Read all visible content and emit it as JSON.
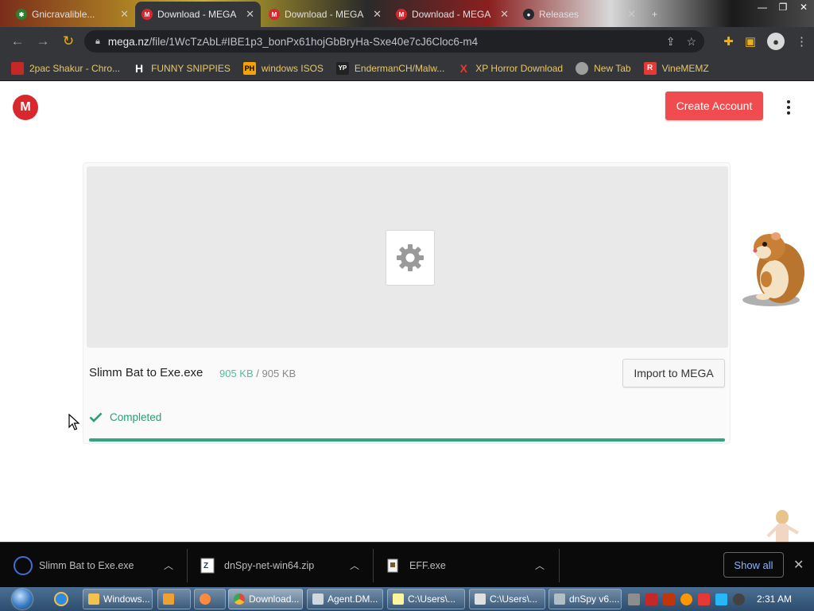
{
  "browser": {
    "tabs": [
      {
        "title": "Gnicravalible...",
        "favicon": "green-leaf-icon",
        "active": false
      },
      {
        "title": "Download - MEGA",
        "favicon": "mega-icon",
        "active": true
      },
      {
        "title": "Download - MEGA",
        "favicon": "mega-icon",
        "active": false
      },
      {
        "title": "Download - MEGA",
        "favicon": "mega-icon",
        "active": false
      },
      {
        "title": "Releases",
        "favicon": "github-icon",
        "active": false
      }
    ],
    "new_tab": "+",
    "address": {
      "domain": "mega.nz",
      "path": "/file/1WcTzAbL#IBE1p3_bonPx61hojGbBryHa-Sxe40e7cJ6Cloc6-m4"
    },
    "bookmarks": [
      {
        "label": "2pac Shakur - Chro...",
        "icon": "chrome-web-store-icon",
        "icon_text": "",
        "icon_color": "#c62828"
      },
      {
        "label": "FUNNY SNIPPIES",
        "icon": "h-icon",
        "icon_text": "H",
        "icon_color": "#ffffff"
      },
      {
        "label": "windows ISOS",
        "icon": "ph-icon",
        "icon_text": "PH",
        "icon_color": "#f7a400"
      },
      {
        "label": "EndermanCH/Malw...",
        "icon": "yp-icon",
        "icon_text": "YP",
        "icon_color": "#ffffff"
      },
      {
        "label": "XP Horror Download",
        "icon": "x-icon",
        "icon_text": "X",
        "icon_color": "#e53935"
      },
      {
        "label": "New Tab",
        "icon": "globe-icon",
        "icon_text": "",
        "icon_color": "#9e9e9e"
      },
      {
        "label": "VineMEMZ",
        "icon": "r-icon",
        "icon_text": "R",
        "icon_color": "#e53935"
      }
    ]
  },
  "page": {
    "logo_letter": "M",
    "create_account": "Create Account",
    "file": {
      "name": "Slimm Bat to Exe.exe",
      "downloaded": "905 KB",
      "separator": "/",
      "total": "905 KB"
    },
    "import_button": "Import to MEGA",
    "status": "Completed",
    "progress": 1.0
  },
  "downloads": [
    {
      "name": "Slimm Bat to Exe.exe",
      "icon": "loading-ring-icon"
    },
    {
      "name": "dnSpy-net-win64.zip",
      "icon": "zip-file-icon"
    },
    {
      "name": "EFF.exe",
      "icon": "exe-file-icon"
    }
  ],
  "show_all": "Show all",
  "taskbar": {
    "items": [
      {
        "label": "Windows...",
        "icon": "explorer-icon",
        "color": "#f2c14e"
      },
      {
        "label": "",
        "icon": "media-player-icon",
        "color": "#f0a030"
      },
      {
        "label": "",
        "icon": "app-icon",
        "color": "#ff8a3d"
      },
      {
        "label": "Download...",
        "icon": "chrome-icon",
        "color": "#e8453c",
        "active": true
      },
      {
        "label": "Agent.DM...",
        "icon": "window-icon",
        "color": "#cfd8dc"
      },
      {
        "label": "C:\\Users\\...",
        "icon": "notepad-icon",
        "color": "#fff59d"
      },
      {
        "label": "C:\\Users\\...",
        "icon": "7zip-icon",
        "color": "#e0e0e0"
      },
      {
        "label": "dnSpy v6....",
        "icon": "dnspy-icon",
        "color": "#b0bec5"
      }
    ],
    "clock": "2:31 AM"
  },
  "colors": {
    "mega_red": "#d9272e",
    "create_btn": "#f04c4f",
    "success_green": "#2fa67c",
    "size_green": "#4dbf9c"
  }
}
